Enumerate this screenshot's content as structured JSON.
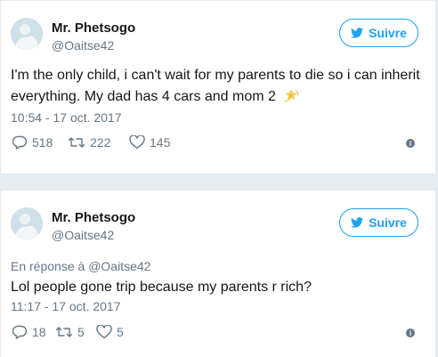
{
  "tweets": [
    {
      "author_name": "Mr. Phetsogo",
      "author_handle": "@Oaitse42",
      "follow_label": "Suivre",
      "text": "I'm the only child, i can't wait for my parents to die so i can inherit everything. My dad has 4 cars and mom 2",
      "emoji_icon": "dizzy-star-icon",
      "timestamp": "10:54 - 17 oct. 2017",
      "replies": "518",
      "retweets": "222",
      "likes": "145"
    },
    {
      "author_name": "Mr. Phetsogo",
      "author_handle": "@Oaitse42",
      "follow_label": "Suivre",
      "reply_prefix": "En réponse à",
      "reply_handle": "@Oaitse42",
      "text": "Lol people gone trip because my parents r rich?",
      "timestamp": "11:17 - 17 oct. 2017",
      "replies": "18",
      "retweets": "5",
      "likes": "5"
    }
  ],
  "colors": {
    "accent": "#1da1f2",
    "secondary_text": "#657786",
    "background": "#e6ecf0"
  }
}
